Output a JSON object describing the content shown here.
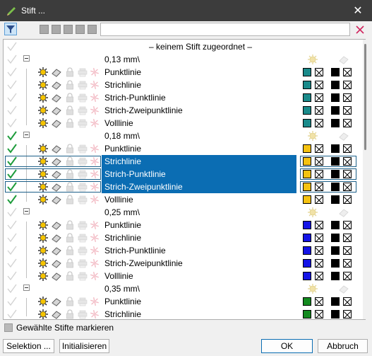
{
  "window": {
    "title": "Stift ..."
  },
  "search": {
    "value": ""
  },
  "unassigned_label": "– keinem Stift zugeordnet –",
  "groups": [
    {
      "label": "0,13 mm\\",
      "color": "#1a8a8a",
      "items": [
        "Punktlinie",
        "Strichlinie",
        "Strich-Punktlinie",
        "Strich-Zweipunktlinie",
        "Volllinie"
      ]
    },
    {
      "label": "0,18 mm\\",
      "color": "#f5c211",
      "items": [
        "Punktlinie",
        "Strichlinie",
        "Strich-Punktlinie",
        "Strich-Zweipunktlinie",
        "Volllinie"
      ]
    },
    {
      "label": "0,25 mm\\",
      "color": "#1414e6",
      "items": [
        "Punktlinie",
        "Strichlinie",
        "Strich-Punktlinie",
        "Strich-Zweipunktlinie",
        "Volllinie"
      ]
    },
    {
      "label": "0,35 mm\\",
      "color": "#138a1f",
      "items": [
        "Punktlinie",
        "Strichlinie"
      ]
    }
  ],
  "footer": {
    "mark_label": "Gewählte Stifte markieren",
    "buttons": {
      "selection": "Selektion ...",
      "init": "Initialisieren",
      "ok": "OK",
      "cancel": "Abbruch"
    }
  },
  "colors": {
    "selection": "#0b6db3",
    "check_active": "#1e9c3c",
    "check_inactive": "#d2d2d2"
  }
}
